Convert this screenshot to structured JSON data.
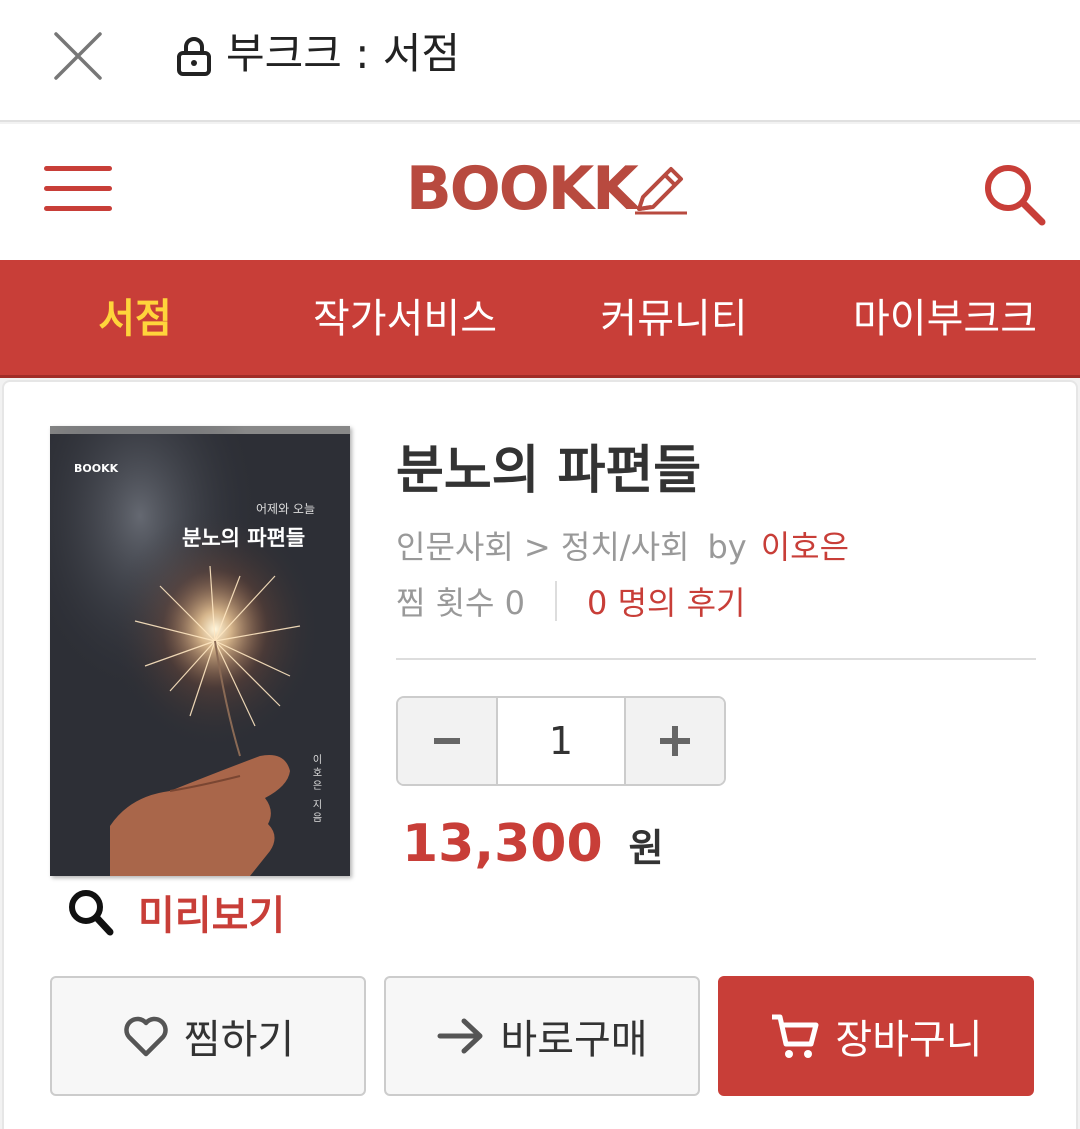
{
  "browser": {
    "title": "부크크 : 서점",
    "close_icon": "close-icon",
    "lock_icon": "lock-icon"
  },
  "header": {
    "logo_text": "BOOKK",
    "menu_icon": "hamburger-menu-icon",
    "search_icon": "search-icon"
  },
  "nav": {
    "items": [
      {
        "label": "서점",
        "active": true
      },
      {
        "label": "작가서비스",
        "active": false
      },
      {
        "label": "커뮤니티",
        "active": false
      },
      {
        "label": "마이부크크",
        "active": false
      }
    ]
  },
  "book": {
    "cover": {
      "brand": "BOOKK",
      "subtitle": "어제와 오늘",
      "title": "분노의 파편들",
      "author_vertical": "이호은 지음"
    },
    "preview_label": "미리보기",
    "title": "분노의 파편들",
    "category": "인문사회 > 정치/사회",
    "by_label": "by",
    "author": "이호은",
    "wish_count_label": "찜 횟수 0",
    "reviews_label": "0 명의 후기",
    "quantity": "1",
    "price": "13,300",
    "currency": "원"
  },
  "actions": {
    "wish_label": "찜하기",
    "buy_now_label": "바로구매",
    "cart_label": "장바구니"
  },
  "colors": {
    "brand_red": "#c83e38",
    "nav_active": "#ffd43b"
  }
}
